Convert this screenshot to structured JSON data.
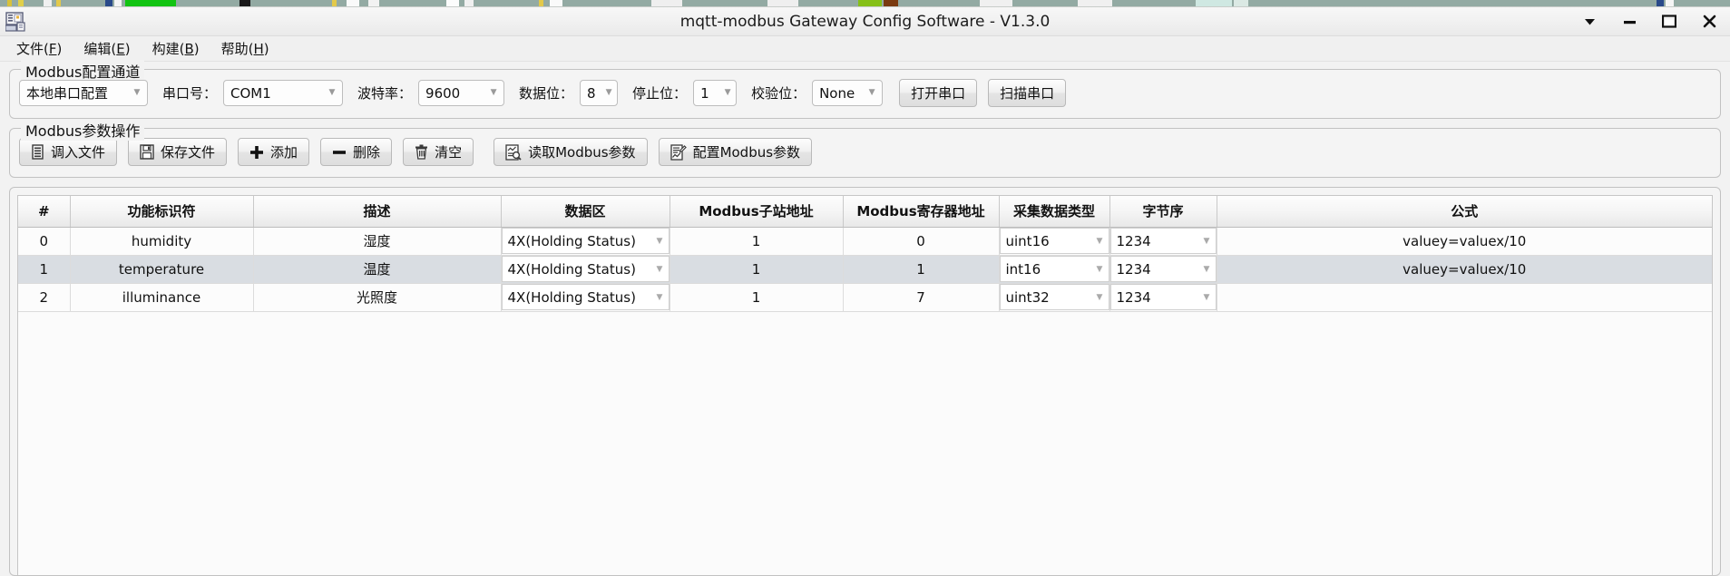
{
  "window": {
    "title": "mqtt-modbus Gateway Config Software - V1.3.0",
    "icon": "computer-config-icon",
    "controls": {
      "dropdown": "chevron-down-icon",
      "minimize": "minimize-icon",
      "maximize": "maximize-icon",
      "close": "close-icon"
    }
  },
  "menu": {
    "items": [
      {
        "text": "文件",
        "mnemonic": "F"
      },
      {
        "text": "编辑",
        "mnemonic": "E"
      },
      {
        "text": "构建",
        "mnemonic": "B"
      },
      {
        "text": "帮助",
        "mnemonic": "H"
      }
    ]
  },
  "channel_group": {
    "title": "Modbus配置通道",
    "connection_mode": "本地串口配置",
    "fields": [
      {
        "label": "串口号：",
        "value": "COM1"
      },
      {
        "label": "波特率：",
        "value": "9600"
      },
      {
        "label": "数据位：",
        "value": "8"
      },
      {
        "label": "停止位：",
        "value": "1"
      },
      {
        "label": "校验位：",
        "value": "None"
      }
    ],
    "open_port_button": "打开串口",
    "scan_port_button": "扫描串口"
  },
  "param_group": {
    "title": "Modbus参数操作",
    "buttons": [
      {
        "label": "调入文件",
        "icon": "import-file-icon"
      },
      {
        "label": "保存文件",
        "icon": "save-floppy-icon"
      },
      {
        "label": "添加",
        "icon": "plus-icon"
      },
      {
        "label": "删除",
        "icon": "minus-icon"
      },
      {
        "label": "清空",
        "icon": "trash-icon"
      },
      {
        "label": "读取Modbus参数",
        "icon": "read-params-icon"
      },
      {
        "label": "配置Modbus参数",
        "icon": "config-params-icon"
      }
    ]
  },
  "table": {
    "headers": [
      "#",
      "功能标识符",
      "描述",
      "数据区",
      "Modbus子站地址",
      "Modbus寄存器地址",
      "采集数据类型",
      "字节序",
      "公式"
    ],
    "rows": [
      {
        "index": "0",
        "identifier": "humidity",
        "description": "湿度",
        "data_area": "4X(Holding Status)",
        "slave_address": "1",
        "register_address": "0",
        "data_type": "uint16",
        "byte_order": "1234",
        "formula": "valuey=valuex/10",
        "selected": false
      },
      {
        "index": "1",
        "identifier": "temperature",
        "description": "温度",
        "data_area": "4X(Holding Status)",
        "slave_address": "1",
        "register_address": "1",
        "data_type": "int16",
        "byte_order": "1234",
        "formula": "valuey=valuex/10",
        "selected": true
      },
      {
        "index": "2",
        "identifier": "illuminance",
        "description": "光照度",
        "data_area": "4X(Holding Status)",
        "slave_address": "1",
        "register_address": "7",
        "data_type": "uint32",
        "byte_order": "1234",
        "formula": "",
        "selected": false
      }
    ]
  },
  "colors": {
    "desktop": "#93aaa3",
    "window_bg": "#f2f2f2",
    "selected_row": "#d9dde2",
    "border": "#c2c2c2"
  }
}
